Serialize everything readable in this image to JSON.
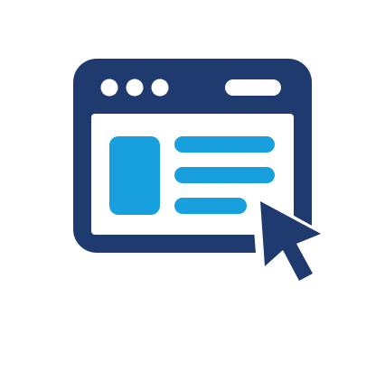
{
  "icon": {
    "name": "web-page-click-icon",
    "colors": {
      "frame": "#1f3a6f",
      "accent": "#17a0dd",
      "background": "#ffffff"
    }
  }
}
